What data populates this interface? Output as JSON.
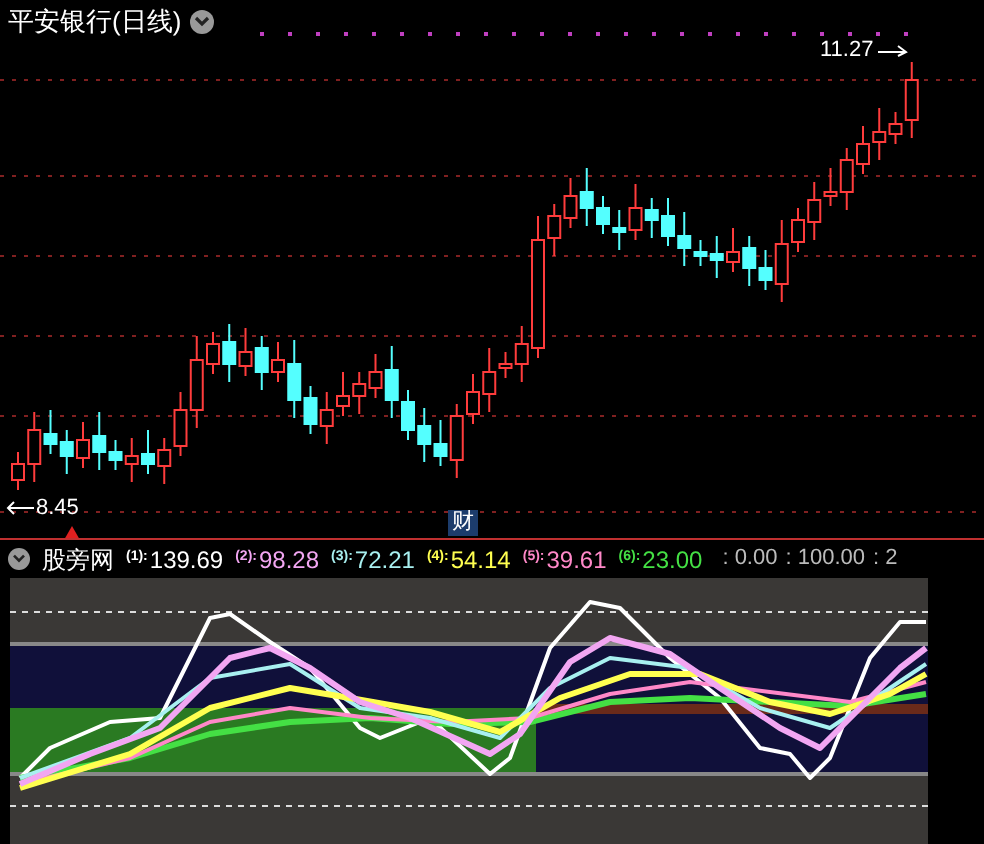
{
  "stock": {
    "title": "平安银行(日线)"
  },
  "price_chart": {
    "high_label": "11.27",
    "low_label": "8.45",
    "event_badge": "财"
  },
  "indicator": {
    "name": "股旁网",
    "values": [
      {
        "index": "(1):",
        "value": "139.69",
        "color": "#ffffff"
      },
      {
        "index": "(2):",
        "value": "98.28",
        "color": "#f2a6f2"
      },
      {
        "index": "(3):",
        "value": "72.21",
        "color": "#a8f0f0"
      },
      {
        "index": "(4):",
        "value": "54.14",
        "color": "#ffff50"
      },
      {
        "index": "(5):",
        "value": "39.61",
        "color": "#ff88c8"
      },
      {
        "index": "(6):",
        "value": "23.00",
        "color": "#44e044"
      }
    ],
    "scale": [
      ": 0.00",
      ": 100.00",
      ": 2"
    ]
  }
}
